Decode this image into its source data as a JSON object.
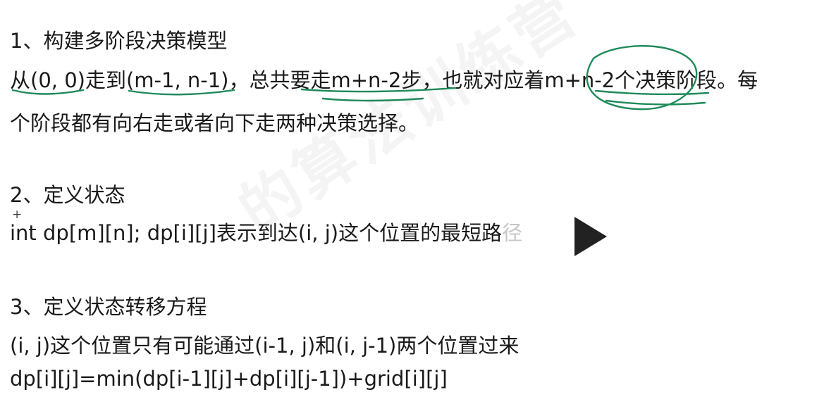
{
  "watermark": "的算法训练营",
  "section1": {
    "heading": "1、构建多阶段决策模型",
    "line1": "从(0, 0)走到(m-1, n-1)，总共要走m+n-2步，也就对应着m+n-2个决策阶段。每",
    "line2": "个阶段都有向右走或者向下走两种决策选择。"
  },
  "section2": {
    "heading": "2、定义状态",
    "cursor_glyph": "+",
    "code_main": "int  dp[m][n]; dp[i][j]表示到达(i, j)这个位置的最短路",
    "code_faded": "径"
  },
  "section3": {
    "heading": "3、定义状态转移方程",
    "line1": "(i, j)这个位置只有可能通过(i-1, j)和(i, j-1)两个位置过来",
    "line2": "dp[i][j]=min(dp[i-1][j]+dp[i][j-1])+grid[i][j]"
  },
  "colors": {
    "annotation_ink": "#1f8a5a",
    "text": "#1a1a1a"
  },
  "icons": {
    "play": "play-icon"
  }
}
